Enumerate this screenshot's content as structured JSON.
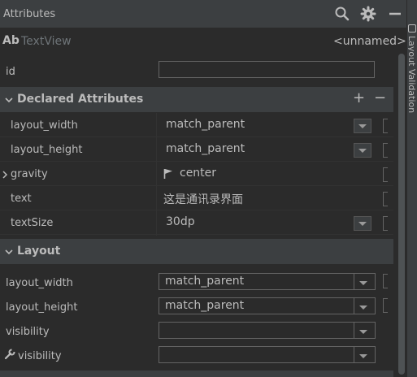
{
  "panel": {
    "title": "Attributes"
  },
  "toolbar": {
    "search": "search-icon",
    "settings": "gear-icon",
    "minimize": "minimize-icon"
  },
  "component": {
    "icon_text": "Ab",
    "type": "TextView",
    "id_value": "<unnamed>"
  },
  "side_tab": {
    "label": "Layout Validation"
  },
  "id_field": {
    "label": "id",
    "value": ""
  },
  "declared": {
    "title": "Declared Attributes",
    "add": "+",
    "remove": "−",
    "rows": [
      {
        "label": "layout_width",
        "value": "match_parent"
      },
      {
        "label": "layout_height",
        "value": "match_parent"
      },
      {
        "label": "gravity",
        "value": "center"
      },
      {
        "label": "text",
        "value": "这是通讯录界面"
      },
      {
        "label": "textSize",
        "value": "30dp"
      }
    ]
  },
  "layout": {
    "title": "Layout",
    "rows": [
      {
        "label": "layout_width",
        "value": "match_parent"
      },
      {
        "label": "layout_height",
        "value": "match_parent"
      },
      {
        "label": "visibility",
        "value": ""
      },
      {
        "label": "visibility",
        "value": ""
      }
    ]
  },
  "colors": {
    "background": "#2b2b2b",
    "header": "#3c3f41",
    "text": "#bbbbbb",
    "muted": "#6e7478",
    "border": "#646464"
  }
}
